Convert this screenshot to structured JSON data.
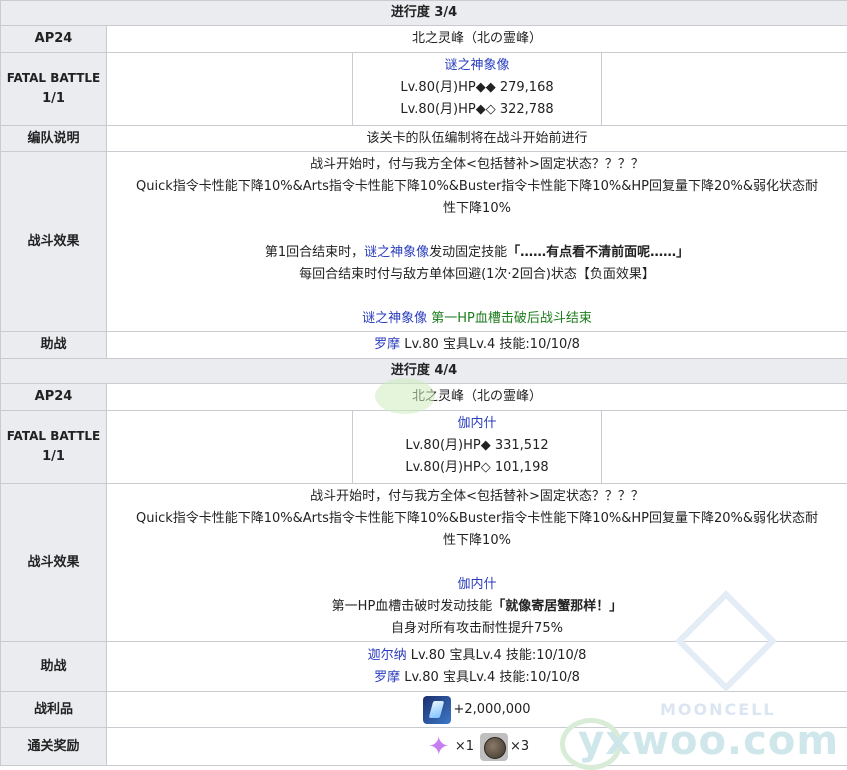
{
  "stage3": {
    "header": "进行度 3/4",
    "ap_label": "AP24",
    "location": "北之灵峰（北の霊峰）",
    "fatal_line1": "FATAL BATTLE",
    "fatal_line2": "1/1",
    "enemy_name": "谜之神象像",
    "enemy_hp1": "Lv.80(月)HP◆◆ 279,168",
    "enemy_hp2": "Lv.80(月)HP◆◇ 322,788",
    "formation_label": "编队说明",
    "formation_text": "该关卡的队伍编制将在战斗开始前进行",
    "effect_label": "战斗效果",
    "effect_line1": "战斗开始时，付与我方全体<包括替补>固定状态？？？？",
    "effect_line2": "Quick指令卡性能下降10%&Arts指令卡性能下降10%&Buster指令卡性能下降10%&HP回复量下降20%&弱化状态耐",
    "effect_line3": "性下降10%",
    "effect_line4_a": "第1回合结束时，",
    "effect_line4_b": "谜之神象像",
    "effect_line4_c": "发动固定技能",
    "effect_line4_d": "「……有点看不清前面呢……」",
    "effect_line5": "每回合结束时付与敌方单体回避(1次·2回合)状态【负面效果】",
    "effect_line6_a": "谜之神象像",
    "effect_line6_b": "第一HP血槽击破后战斗结束",
    "support_label": "助战",
    "support_name": "罗摩",
    "support_text": "Lv.80 宝具Lv.4 技能:10/10/8"
  },
  "stage4": {
    "header": "进行度 4/4",
    "ap_label": "AP24",
    "location": "北之灵峰（北の霊峰）",
    "fatal_line1": "FATAL BATTLE",
    "fatal_line2": "1/1",
    "enemy_name": "伽内什",
    "enemy_hp1": "Lv.80(月)HP◆ 331,512",
    "enemy_hp2": "Lv.80(月)HP◇ 101,198",
    "effect_label": "战斗效果",
    "effect_line1": "战斗开始时，付与我方全体<包括替补>固定状态？？？？",
    "effect_line2": "Quick指令卡性能下降10%&Arts指令卡性能下降10%&Buster指令卡性能下降10%&HP回复量下降20%&弱化状态耐",
    "effect_line3": "性下降10%",
    "effect_line4": "伽内什",
    "effect_line5_a": "第一HP血槽击破时发动技能",
    "effect_line5_b": "「就像寄居蟹那样！」",
    "effect_line6": "自身对所有攻击耐性提升75%",
    "support_label": "助战",
    "support1_name": "迦尔纳",
    "support1_text": "Lv.80 宝具Lv.4 技能:10/10/8",
    "support2_name": "罗摩",
    "support2_text": "Lv.80 宝具Lv.4 技能:10/10/8",
    "loot_label": "战利品",
    "loot_value": "+2,000,000",
    "reward_label": "通关奖励",
    "reward1_count": "×1",
    "reward2_count": "×3"
  },
  "icons": {
    "loot": "qp-crystal-icon",
    "reward1": "saint-quartz-star-icon",
    "reward2": "bronze-coin-icon"
  },
  "watermark": {
    "site": "yxwoo.com",
    "brand": "MOONCELL"
  }
}
